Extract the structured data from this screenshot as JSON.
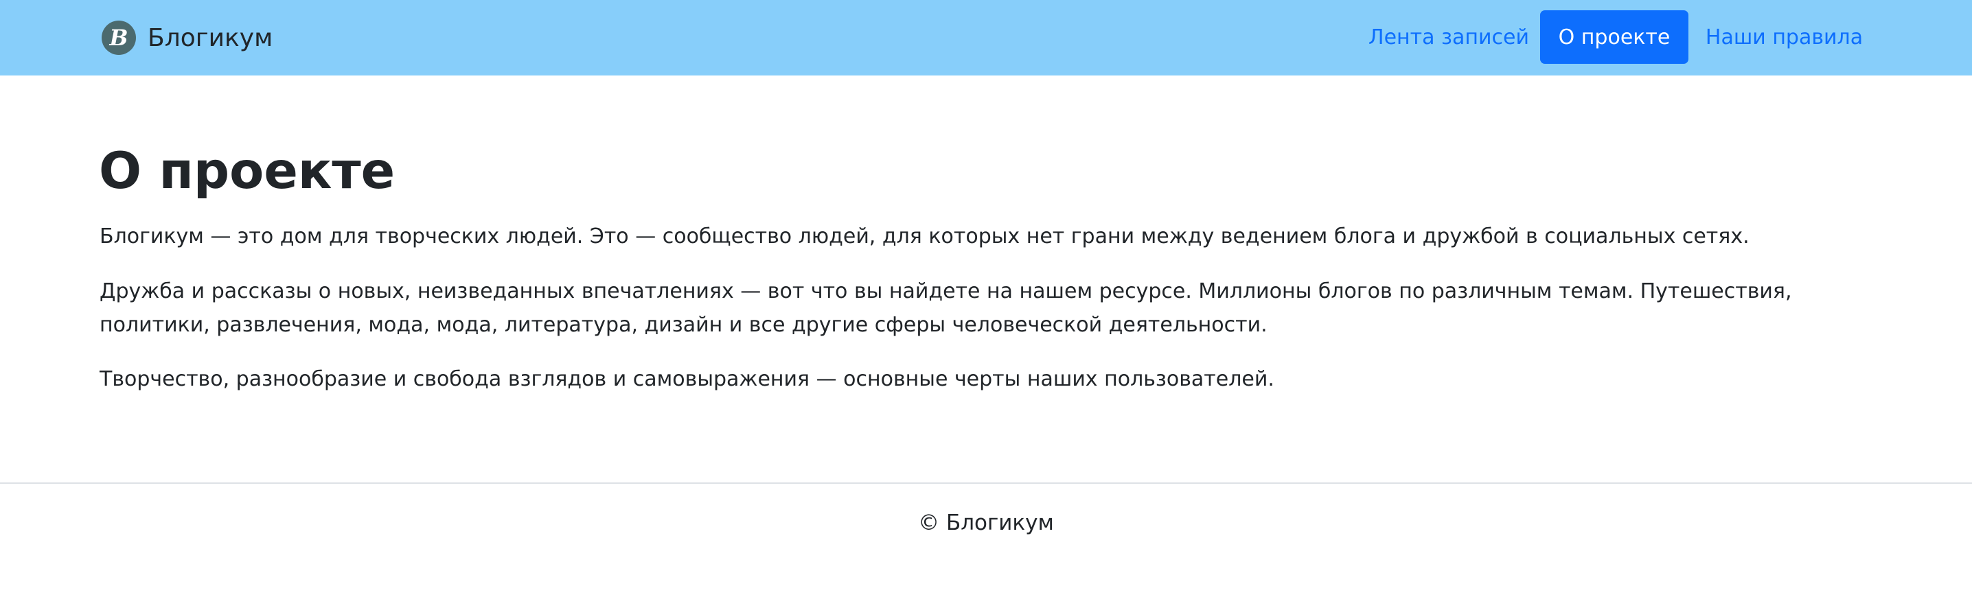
{
  "navbar": {
    "brand_logo_letter": "B",
    "brand_name": "Блогикум",
    "links": [
      {
        "label": "Лента записей",
        "active": false
      },
      {
        "label": "О проекте",
        "active": true
      },
      {
        "label": "Наши правила",
        "active": false
      }
    ]
  },
  "main": {
    "title": "О проекте",
    "paragraphs": [
      "Блогикум — это дом для творческих людей. Это — сообщество людей, для которых нет грани между ведением блога и дружбой в социальных сетях.",
      "Дружба и рассказы о новых, неизведанных впечатлениях — вот что вы найдете на нашем ресурсе. Миллионы блогов по различным темам. Путешествия, политики, развлечения, мода, мода, литература, дизайн и все другие сферы человеческой деятельности.",
      "Творчество, разнообразие и свобода взглядов и самовыражения — основные черты наших пользователей."
    ]
  },
  "footer": {
    "text": "© Блогикум"
  },
  "colors": {
    "navbar_bg": "#87cefa",
    "link": "#0d6efd",
    "active_bg": "#0d6efd",
    "text": "#212529"
  }
}
